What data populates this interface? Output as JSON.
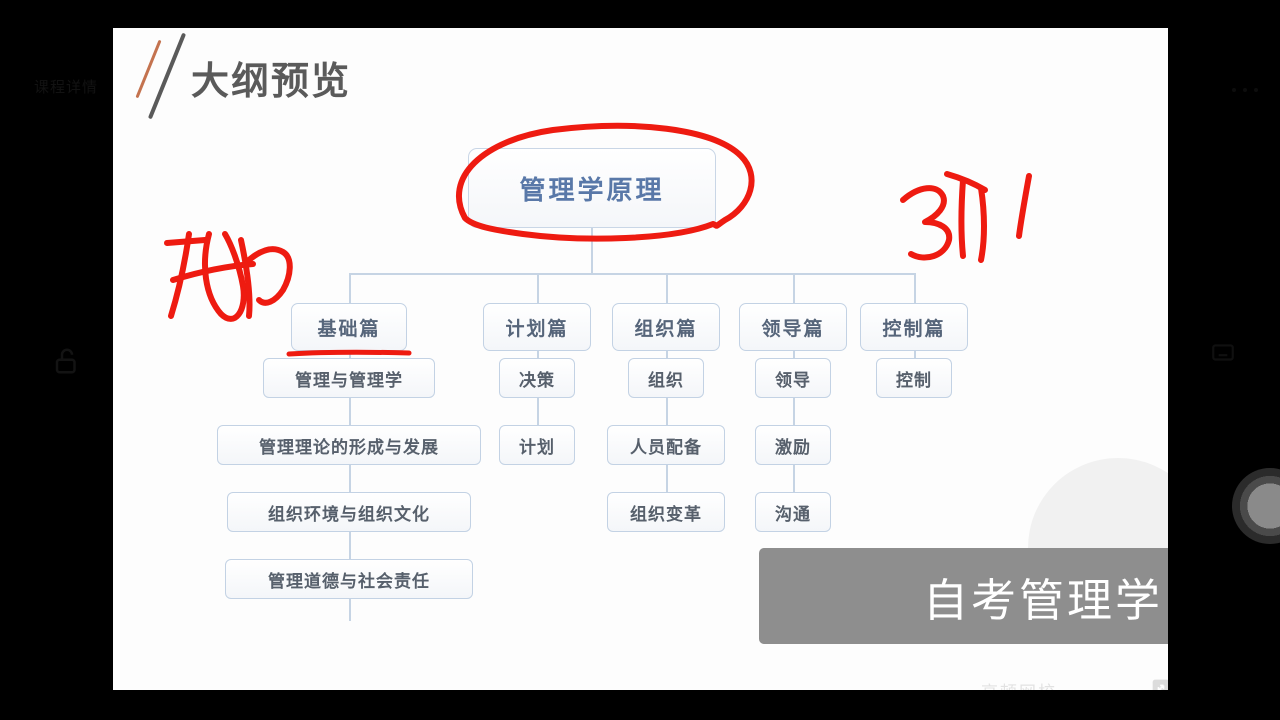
{
  "player": {
    "faint_top_label": "课程详情",
    "lock_icon": "unlock-icon",
    "more_icon": "more-options-icon",
    "cast_icon": "cast-icon",
    "volume_knob": "volume-knob",
    "home_indicator": "home-indicator"
  },
  "slide": {
    "title": "大纲预览",
    "decor": {
      "slash_short": "slash-mark-orange",
      "slash_long": "slash-mark-gray"
    },
    "root": {
      "label": "管理学原理"
    },
    "branches": [
      {
        "label": "基础篇",
        "underlined": true,
        "children": [
          "管理与管理学",
          "管理理论的形成与发展",
          "组织环境与组织文化",
          "管理道德与社会责任"
        ]
      },
      {
        "label": "计划篇",
        "underlined": false,
        "children": [
          "决策",
          "计划"
        ]
      },
      {
        "label": "组织篇",
        "underlined": false,
        "children": [
          "组织",
          "人员配备",
          "组织变革"
        ]
      },
      {
        "label": "领导篇",
        "underlined": false,
        "children": [
          "领导",
          "激励",
          "沟通"
        ]
      },
      {
        "label": "控制篇",
        "underlined": false,
        "children": [
          "控制"
        ]
      }
    ],
    "annotations": {
      "root_circle": "red-circle-around-root",
      "left_scrawl": "red-handwriting-left",
      "right_scrawl": "red-handwriting-right",
      "branch_underline": "red-underline-under-jichupian"
    }
  },
  "overlay": {
    "banner_text": "自考管理学",
    "watermark_text": "高顿网校",
    "expand_icon": "fullscreen-expand-icon"
  },
  "colors": {
    "node_border": "#c3d2e4",
    "node_text": "#57606c",
    "root_text": "#5978a8",
    "title_text": "#5a5a5a",
    "pen_red": "#ee1b11",
    "banner_bg": "#8e8e8e",
    "slide_bg": "#fdfdfd",
    "player_bg": "#000000"
  }
}
